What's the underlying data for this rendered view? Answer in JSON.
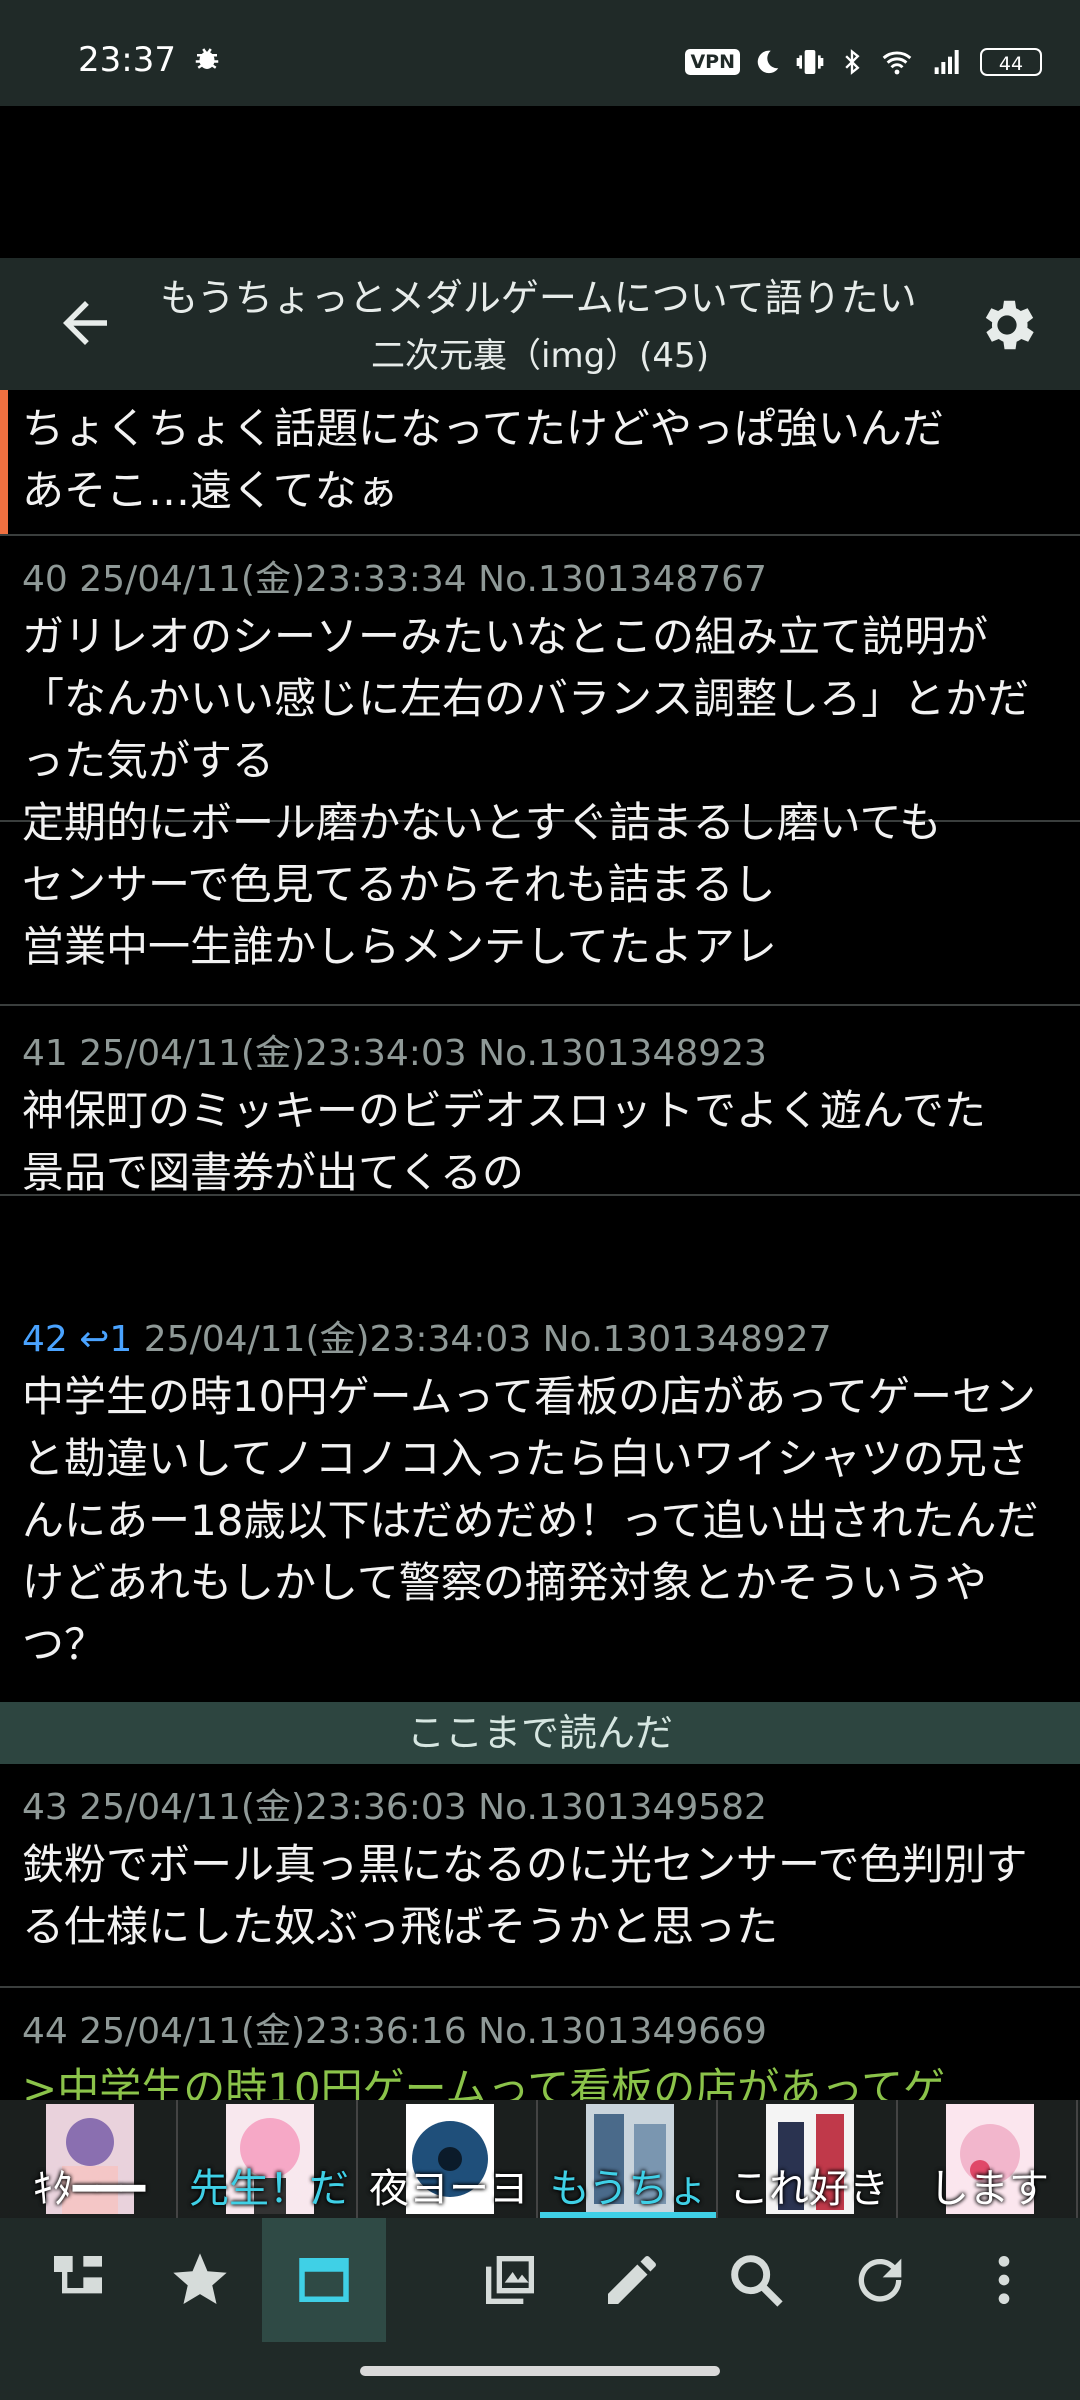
{
  "status": {
    "time": "23:37",
    "vpn": "VPN",
    "battery": "44"
  },
  "appbar": {
    "title": "もうちょっとメダルゲームについて語りたい",
    "subtitle": "二次元裏（img）(45)"
  },
  "posts": [
    {
      "body": "ちょくちょく話題になってたけどやっぱ強いんだ\nあそこ…遠くてなぁ"
    },
    {
      "meta": "40 25/04/11(金)23:33:34 No.1301348767",
      "body": "ガリレオのシーソーみたいなとこの組み立て説明が「なんかいい感じに左右のバランス調整しろ」とかだった気がする\n定期的にボール磨かないとすぐ詰まるし磨いても\nセンサーで色見てるからそれも詰まるし\n営業中一生誰かしらメンテしてたよアレ"
    },
    {
      "meta": "41 25/04/11(金)23:34:03 No.1301348923",
      "body": "神保町のミッキーのビデオスロットでよく遊んでた\n景品で図書券が出てくるの"
    },
    {
      "meta_no": "42",
      "meta_reply": "1",
      "meta_rest": "25/04/11(金)23:34:03 No.1301348927",
      "body": "中学生の時10円ゲームって看板の店があってゲーセンと勘違いしてノコノコ入ったら白いワイシャツの兄さんにあー18歳以下はだめだめ！って追い出されたんだけどあれもしかして警察の摘発対象とかそういうやつ？"
    },
    {
      "meta": "43 25/04/11(金)23:36:03 No.1301349582",
      "body": "鉄粉でボール真っ黒になるのに光センサーで色判別する仕様にした奴ぶっ飛ばそうかと思った"
    },
    {
      "meta": "44 25/04/11(金)23:36:16 No.1301349669",
      "body": ">中学生の時10円ゲームって看板の店があってゲ"
    }
  ],
  "read_marker": "ここまで読んだ",
  "tabs": [
    {
      "label": "ｷﾀ━━━"
    },
    {
      "label": "先生！だ"
    },
    {
      "label": "夜ヨーヨ"
    },
    {
      "label": "もうちょ"
    },
    {
      "label": "これ好き"
    },
    {
      "label": "します"
    }
  ],
  "bottom_bar": {
    "items": [
      "tree-icon",
      "star-icon",
      "tabs-icon",
      "gallery-icon",
      "edit-icon",
      "search-icon",
      "refresh-icon",
      "more-icon"
    ]
  },
  "colors": {
    "bar_bg": "#202a28",
    "accent": "#3fd0e6",
    "reply_link": "#4aa3ff",
    "quote": "#8bc34a",
    "unread_mark": "#f07040"
  }
}
